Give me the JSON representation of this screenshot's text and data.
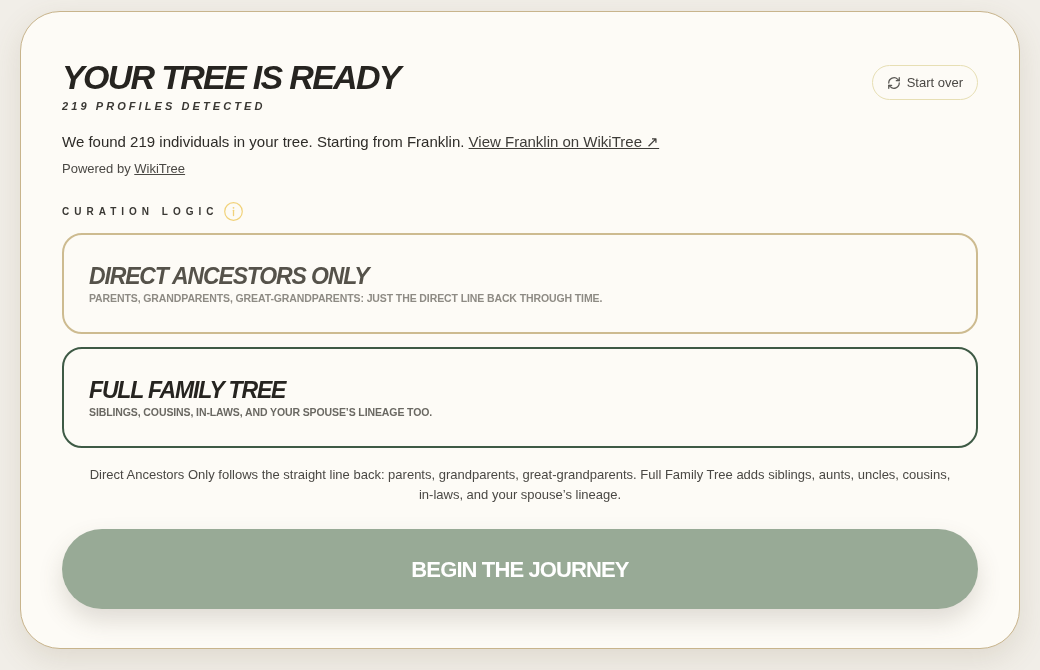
{
  "header": {
    "title": "YOUR TREE IS READY",
    "subtitle": "219 PROFILES DETECTED",
    "start_over": "Start over"
  },
  "summary": {
    "text": "We found 219 individuals in your tree. Starting from Franklin.",
    "link": "View Franklin on WikiTree ↗"
  },
  "powered_by": {
    "text": "Powered by",
    "link": "WikiTree"
  },
  "curation": {
    "label": "CURATION LOGIC",
    "options": [
      {
        "title": "DIRECT ANCESTORS ONLY",
        "description": "PARENTS, GRANDPARENTS, GREAT-GRANDPARENTS: JUST THE DIRECT LINE BACK THROUGH TIME.",
        "selected": false
      },
      {
        "title": "FULL FAMILY TREE",
        "description": "SIBLINGS, COUSINS, IN-LAWS, AND YOUR SPOUSE’S LINEAGE TOO.",
        "selected": true
      }
    ]
  },
  "explanation": "Direct Ancestors Only follows the straight line back: parents, grandparents, great-grandparents. Full Family Tree adds siblings, aunts, uncles, cousins, in-laws, and your spouse’s lineage.",
  "primary_button": "BEGIN THE JOURNEY"
}
